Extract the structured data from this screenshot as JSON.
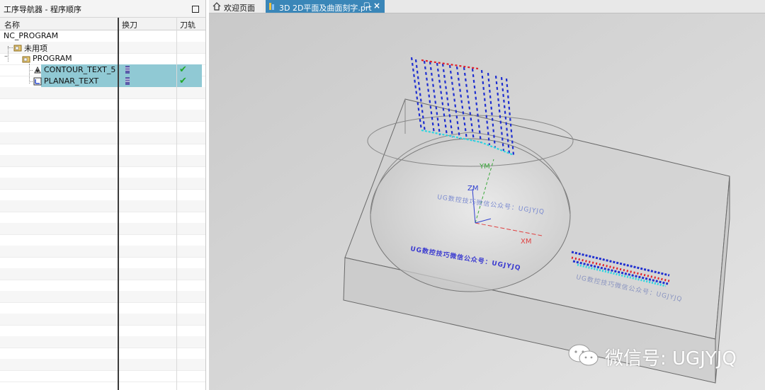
{
  "navigator": {
    "title": "工序导航器 - 程序顺序",
    "columns": [
      "名称",
      "换刀",
      "刀轨"
    ],
    "root": "NC_PROGRAM",
    "unused": "未用项",
    "program": "PROGRAM",
    "operations": [
      {
        "name": "CONTOUR_TEXT_5",
        "status": "ok"
      },
      {
        "name": "PLANAR_TEXT",
        "status": "ok"
      }
    ]
  },
  "tabs": [
    {
      "label": "欢迎页面",
      "icon": "home-icon"
    },
    {
      "label": "3D 2D平面及曲面刻字.prt",
      "icon": "part-icon",
      "active": true
    }
  ],
  "viewport": {
    "axes": {
      "x": "XM",
      "y": "YM",
      "z": "ZM"
    },
    "engraved_text_1": "UG数控技巧微信公众号：UGJYJQ",
    "engraved_text_2": "UG数控技巧微信公众号：UGJYJQ",
    "engraved_text_3": "UG数控技巧微信公众号：UGJYJQ",
    "colors": {
      "toolpath_blue": "#1f2fd0",
      "toolpath_red": "#e0202a",
      "toolpath_cyan": "#2fd6e0",
      "axis_red": "#e04040",
      "axis_green": "#3aa83a",
      "axis_blue": "#3040d0"
    }
  },
  "watermark": "微信号: UGJYJQ"
}
